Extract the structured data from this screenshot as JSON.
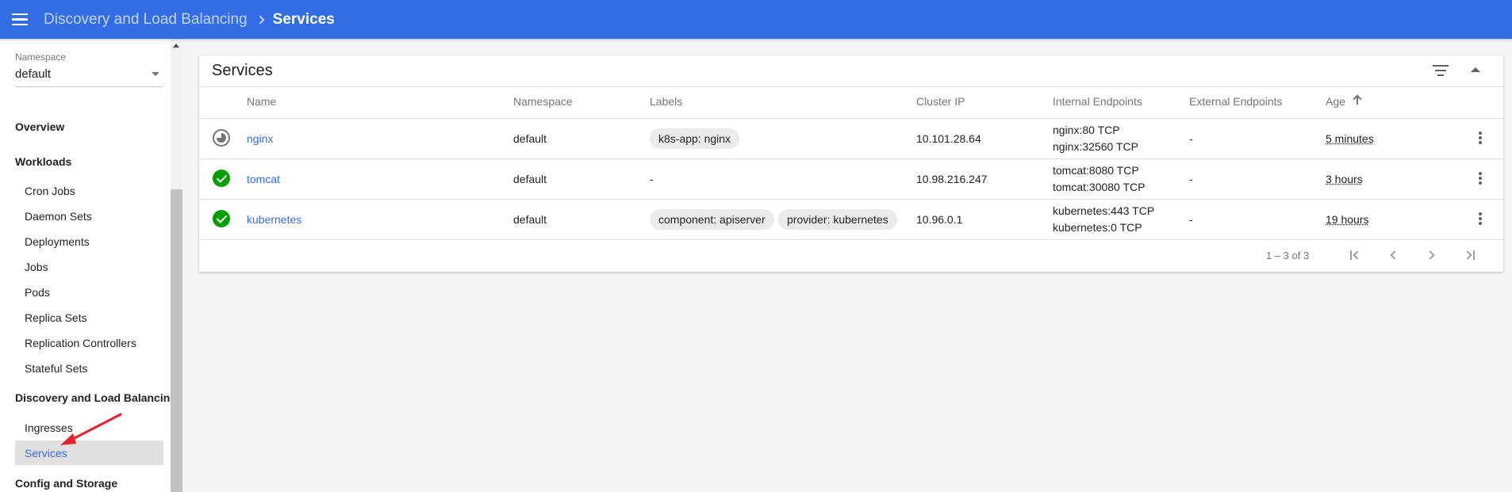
{
  "topbar": {
    "breadcrumb_parent": "Discovery and Load Balancing",
    "breadcrumb_current": "Services",
    "color": "#326de6"
  },
  "sidebar": {
    "namespace_label": "Namespace",
    "namespace_value": "default",
    "overview": "Overview",
    "workloads": "Workloads",
    "workload_items": [
      "Cron Jobs",
      "Daemon Sets",
      "Deployments",
      "Jobs",
      "Pods",
      "Replica Sets",
      "Replication Controllers",
      "Stateful Sets"
    ],
    "discovery": "Discovery and Load Balancing",
    "discovery_items": [
      "Ingresses",
      "Services"
    ],
    "config": "Config and Storage",
    "active_item": "Services"
  },
  "services": {
    "title": "Services",
    "headers": {
      "name": "Name",
      "namespace": "Namespace",
      "labels": "Labels",
      "cluster_ip": "Cluster IP",
      "internal_endpoints": "Internal Endpoints",
      "external_endpoints": "External Endpoints",
      "age": "Age"
    },
    "rows": [
      {
        "status": "pending",
        "name": "nginx",
        "namespace": "default",
        "labels": [
          "k8s-app: nginx"
        ],
        "cluster_ip": "10.101.28.64",
        "internal_endpoints": [
          "nginx:80 TCP",
          "nginx:32560 TCP"
        ],
        "external_endpoints": "-",
        "age": "5 minutes"
      },
      {
        "status": "ok",
        "name": "tomcat",
        "namespace": "default",
        "labels_text": "-",
        "cluster_ip": "10.98.216.247",
        "internal_endpoints": [
          "tomcat:8080 TCP",
          "tomcat:30080 TCP"
        ],
        "external_endpoints": "-",
        "age": "3 hours"
      },
      {
        "status": "ok",
        "name": "kubernetes",
        "namespace": "default",
        "labels": [
          "component: apiserver",
          "provider: kubernetes"
        ],
        "cluster_ip": "10.96.0.1",
        "internal_endpoints": [
          "kubernetes:443 TCP",
          "kubernetes:0 TCP"
        ],
        "external_endpoints": "-",
        "age": "19 hours"
      }
    ],
    "pagination": "1 – 3 of 3"
  }
}
